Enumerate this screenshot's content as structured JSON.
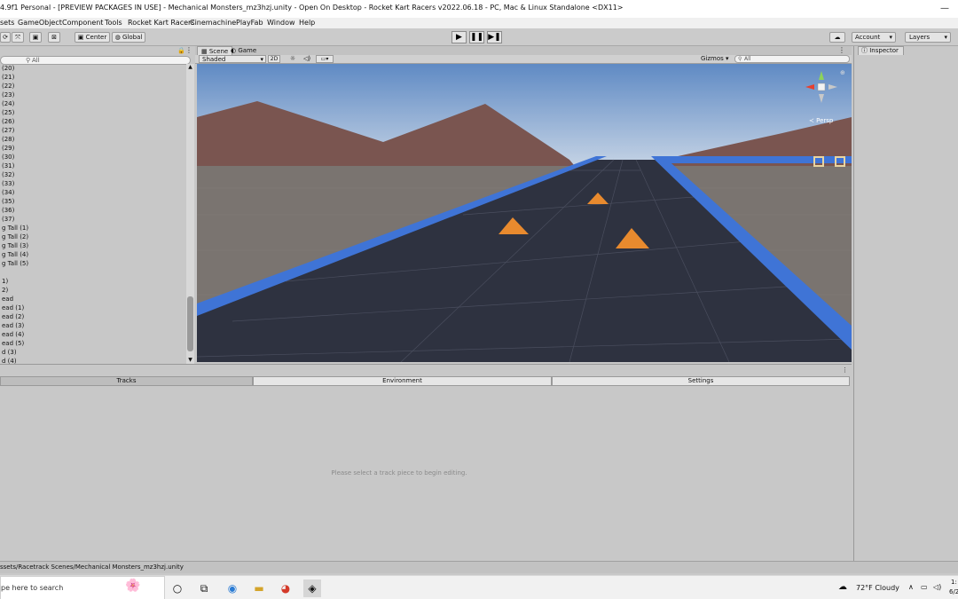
{
  "window": {
    "title": "4.9f1 Personal - [PREVIEW PACKAGES IN USE] - Mechanical Monsters_mz3hzj.unity - Open On Desktop - Rocket Kart Racers v2022.06.18 - PC, Mac & Linux Standalone <DX11>",
    "minimize_glyph": "—"
  },
  "menu": [
    "sets",
    "GameObject",
    "Component",
    "Tools",
    "Rocket Kart Racers",
    "Cinemachine",
    "PlayFab",
    "Window",
    "Help"
  ],
  "toolbar": {
    "pivot_label": "Center",
    "space_label": "Global",
    "account_label": "Account",
    "layers_label": "Layers"
  },
  "hierarchy": {
    "search_placeholder": "All",
    "items": [
      "(20)",
      "(21)",
      "(22)",
      "(23)",
      "(24)",
      "(25)",
      "(26)",
      "(27)",
      "(28)",
      "(29)",
      "(30)",
      "(31)",
      "(32)",
      "(33)",
      "(34)",
      "(35)",
      "(36)",
      "(37)",
      "g Tall (1)",
      "g Tall (2)",
      "g Tall (3)",
      "g Tall (4)",
      "g Tall (5)",
      "",
      "1)",
      "2)",
      "ead",
      "ead (1)",
      "ead (2)",
      "ead (3)",
      "ead (4)",
      "ead (5)",
      "d (3)",
      "d (4)"
    ]
  },
  "scene": {
    "tab_scene": "Scene",
    "tab_game": "Game",
    "shading": "Shaded",
    "mode_2d": "2D",
    "gizmos": "Gizmos",
    "search_placeholder": "All",
    "persp_label": "Persp",
    "colors": {
      "sky_top": "#5f8ac4",
      "sky_horizon": "#c9d6e6",
      "mountain": "#7a5550",
      "ground": "#7a7470",
      "track": "#2e3240",
      "rail": "#3f74d6",
      "cone": "#e88a2e"
    }
  },
  "lower": {
    "tabs": [
      "Tracks",
      "Environment",
      "Settings"
    ],
    "message": "Please select a track piece to begin editing."
  },
  "inspector": {
    "tab_label": "Inspector"
  },
  "status": {
    "path": "ssets/Racetrack Scenes/Mechanical Monsters_mz3hzj.unity"
  },
  "taskbar": {
    "search_placeholder": "pe here to search",
    "weather": "72°F  Cloudy",
    "clock_top": "1:",
    "clock_bottom": "6/2"
  }
}
